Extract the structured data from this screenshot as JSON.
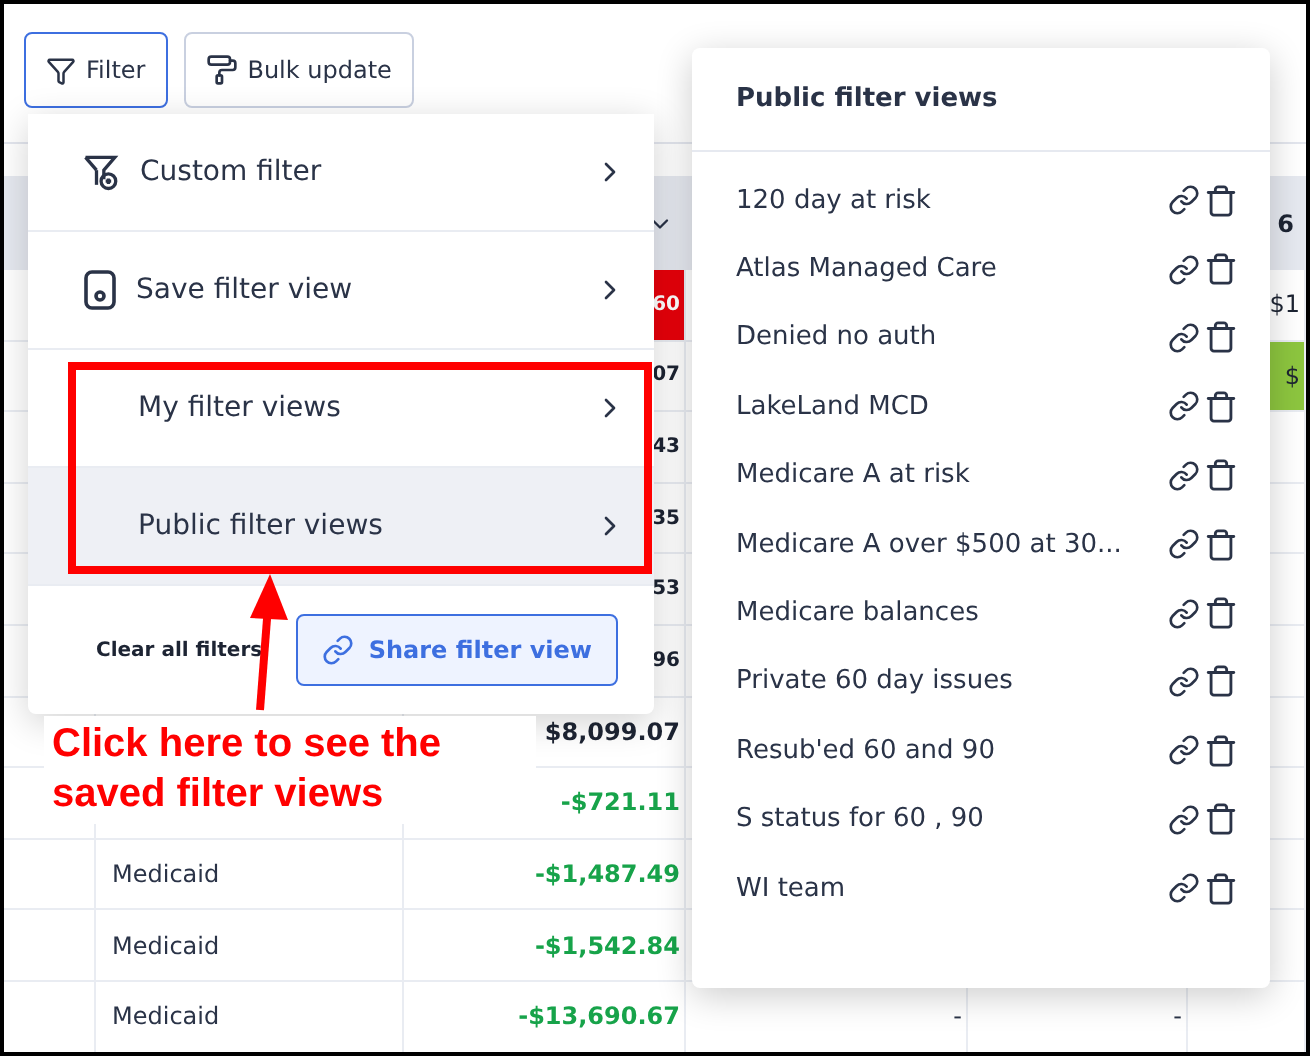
{
  "toolbar": {
    "buttons": [
      {
        "label": "Filter",
        "selected": true
      },
      {
        "label": "Bulk update",
        "selected": false
      }
    ]
  },
  "filter_menu": {
    "items": [
      {
        "label": "Custom filter",
        "selected": false
      },
      {
        "label": "Save filter view",
        "selected": false
      },
      {
        "label": "My filter views",
        "selected": false
      },
      {
        "label": "Public filter views",
        "selected": true
      }
    ],
    "clear_label": "Clear all filters",
    "share_button": "Share filter view"
  },
  "public_views": {
    "title": "Public filter views",
    "items": [
      "120 day at risk",
      "Atlas Managed Care",
      "Denied no auth",
      "LakeLand MCD",
      "Medicare A at risk",
      "Medicare A over $500 at 30...",
      "Medicare balances",
      "Private 60 day issues",
      "Resub'ed 60 and 90",
      "S status for 60 , 90",
      "WI team"
    ]
  },
  "annotation": {
    "text": "Click here to see the saved filter views"
  },
  "table": {
    "header": {
      "column_6": "6"
    },
    "rows": [
      {
        "payer": "",
        "amount": "60",
        "kind": "alert",
        "column_4": "",
        "column_5": "",
        "column_6": "$1",
        "column_6_highlighted": false
      },
      {
        "payer": "",
        "amount": "07",
        "kind": "plain",
        "column_4": "",
        "column_5": "",
        "column_6": "$",
        "column_6_highlighted": true
      },
      {
        "payer": "",
        "amount": "43",
        "kind": "plain",
        "column_4": "",
        "column_5": "",
        "column_6": "",
        "column_6_highlighted": false
      },
      {
        "payer": "",
        "amount": "35",
        "kind": "plain",
        "column_4": "",
        "column_5": "",
        "column_6": "",
        "column_6_highlighted": false
      },
      {
        "payer": "",
        "amount": "53",
        "kind": "plain",
        "column_4": "",
        "column_5": "",
        "column_6": "",
        "column_6_highlighted": false
      },
      {
        "payer": "",
        "amount": "96",
        "kind": "plain",
        "column_4": "",
        "column_5": "",
        "column_6": "",
        "column_6_highlighted": false
      },
      {
        "payer": "",
        "amount": "$8,099.07",
        "kind": "plain",
        "column_4": "",
        "column_5": "",
        "column_6": "",
        "column_6_highlighted": false
      },
      {
        "payer": "",
        "amount": "-$721.11",
        "kind": "credit",
        "column_4": "",
        "column_5": "",
        "column_6": "",
        "column_6_highlighted": false
      },
      {
        "payer": "Medicaid",
        "amount": "-$1,487.49",
        "kind": "credit",
        "column_4": "",
        "column_5": "",
        "column_6": "",
        "column_6_highlighted": false
      },
      {
        "payer": "Medicaid",
        "amount": "-$1,542.84",
        "kind": "credit",
        "column_4": "",
        "column_5": "",
        "column_6": "",
        "column_6_highlighted": false
      },
      {
        "payer": "Medicaid",
        "amount": "-$13,690.67",
        "kind": "credit",
        "column_4": "-",
        "column_5": "-",
        "column_6": "",
        "column_6_highlighted": false
      }
    ]
  }
}
